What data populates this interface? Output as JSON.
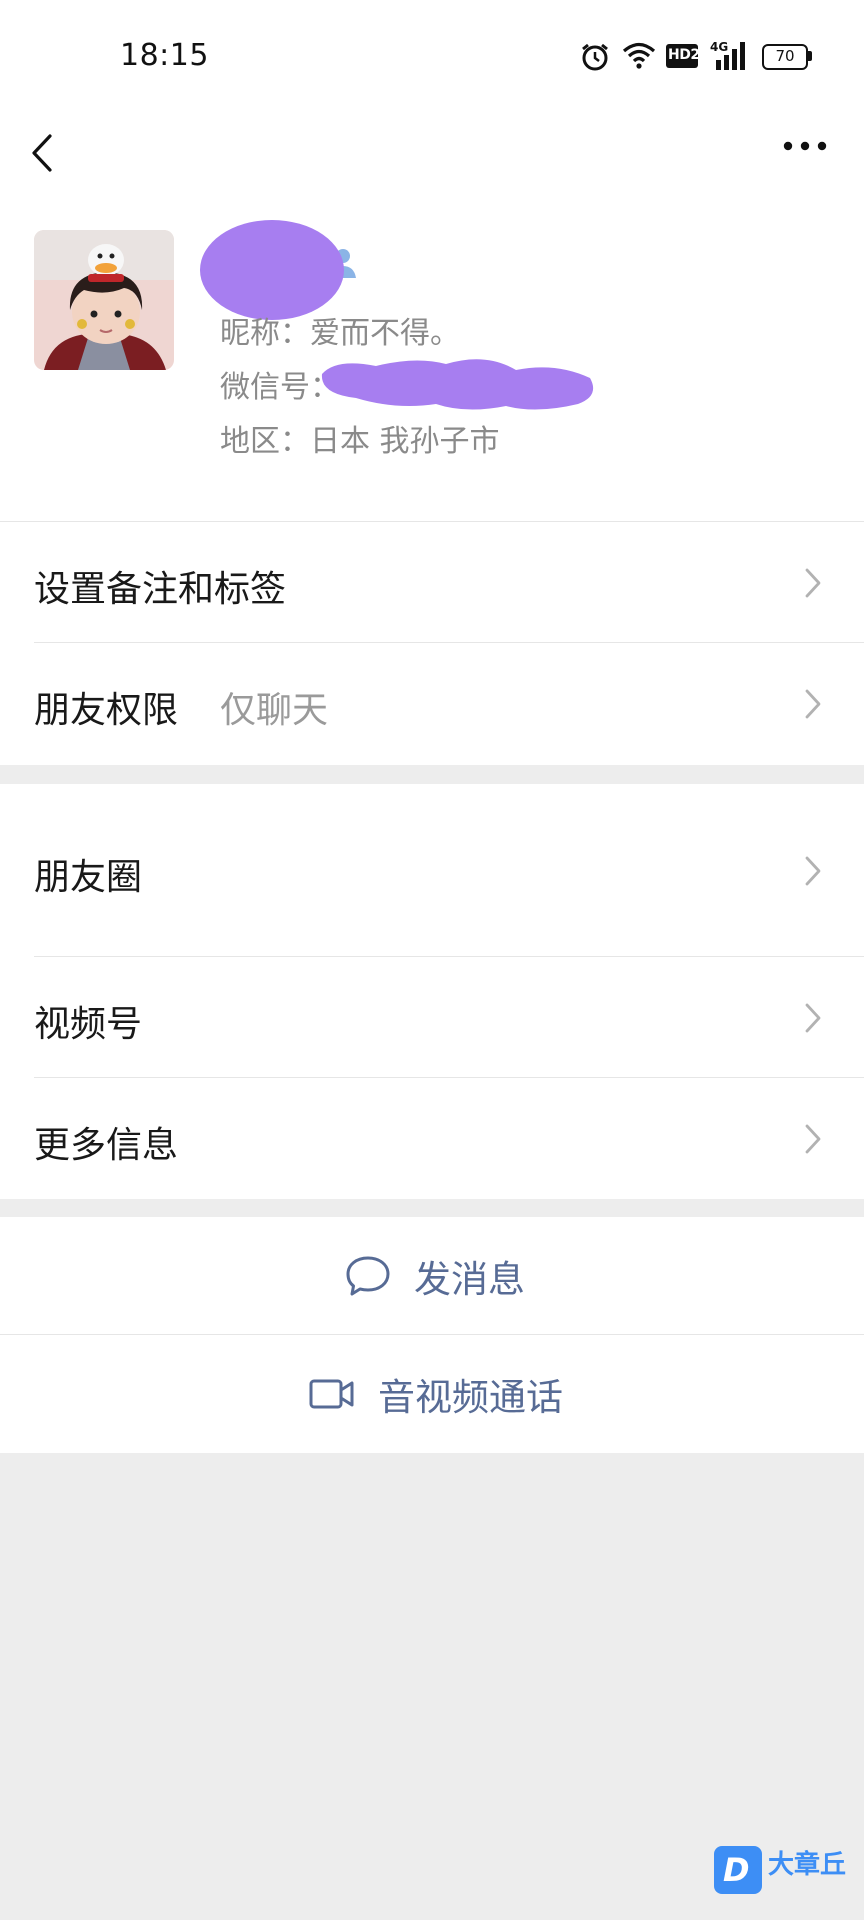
{
  "status_bar": {
    "time": "18:15",
    "network_label": "4G",
    "hd_label": "HD2",
    "battery": "70",
    "icons": [
      "alarm-icon",
      "wifi-icon",
      "hd-icon",
      "signal-icon",
      "battery-icon"
    ]
  },
  "nav": {
    "back_icon": "chevron-left-icon",
    "more_icon": "ellipsis-icon"
  },
  "profile": {
    "nickname_line": "昵称：爱而不得。",
    "wechat_id_label": "微信号：",
    "region_line": "地区：日本 我孙子市",
    "redaction_color": "#a77ef0",
    "gender_icon": "gender-icon"
  },
  "menu": {
    "remark_tags": "设置备注和标签",
    "friend_permission": "朋友权限",
    "friend_permission_value": "仅聊天",
    "moments": "朋友圈",
    "channels": "视频号",
    "more_info": "更多信息"
  },
  "actions": {
    "send_message": "发消息",
    "video_call": "音视频通话",
    "accent_color": "#576b95"
  },
  "watermark": {
    "text": "大章丘"
  }
}
